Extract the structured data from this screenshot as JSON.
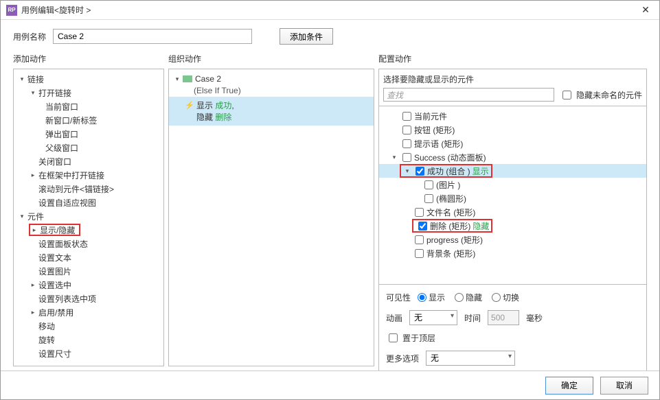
{
  "titlebar": {
    "title": "用例编辑<旋转时 >",
    "icon_label": "RP"
  },
  "name_row": {
    "label": "用例名称",
    "value": "Case 2",
    "add_condition": "添加条件"
  },
  "col_headers": {
    "left": "添加动作",
    "mid": "组织动作",
    "right": "配置动作"
  },
  "left_tree": {
    "link_group": "链接",
    "open_link": "打开链接",
    "open_link_children": [
      "当前窗口",
      "新窗口/新标签",
      "弹出窗口",
      "父级窗口"
    ],
    "close_window": "关闭窗口",
    "open_in_frame": "在框架中打开链接",
    "scroll_to": "滚动到元件<锚链接>",
    "adaptive_view": "设置自适应视图",
    "widget_group": "元件",
    "show_hide": "显示/隐藏",
    "panel_state": "设置面板状态",
    "set_text": "设置文本",
    "set_image": "设置图片",
    "set_selected": "设置选中",
    "set_list": "设置列表选中项",
    "enable_disable": "启用/禁用",
    "move": "移动",
    "rotate": "旋转",
    "set_size": "设置尺寸"
  },
  "mid_panel": {
    "case_name": "Case 2",
    "case_sub": "(Else If True)",
    "action_show": "显示",
    "action_show_target": "成功",
    "action_hide": "隐藏",
    "action_hide_target": "删除"
  },
  "right_panel": {
    "title": "选择要隐藏或显示的元件",
    "search_placeholder": "查找",
    "hide_unnamed": "隐藏未命名的元件",
    "items": {
      "current_widget": "当前元件",
      "button": "按钮 (矩形)",
      "hint": "提示语 (矩形)",
      "success_panel": "Success (动态面板)",
      "success_group": "成功 (组合 )",
      "success_append": "显示",
      "image": "(图片 )",
      "ellipse": "(椭圆形)",
      "file_label": "文件名 (矩形)",
      "delete": "删除 (矩形)",
      "delete_append": "隐藏",
      "progress": "progress (矩形)",
      "bg": "背景条 (矩形)"
    },
    "visibility_label": "可见性",
    "radio_show": "显示",
    "radio_hide": "隐藏",
    "radio_toggle": "切换",
    "anim_label": "动画",
    "anim_value": "无",
    "time_label": "时间",
    "time_value": "500",
    "time_unit": "毫秒",
    "bring_front": "置于顶层",
    "more_label": "更多选项",
    "more_value": "无"
  },
  "footer": {
    "ok": "确定",
    "cancel": "取消"
  }
}
